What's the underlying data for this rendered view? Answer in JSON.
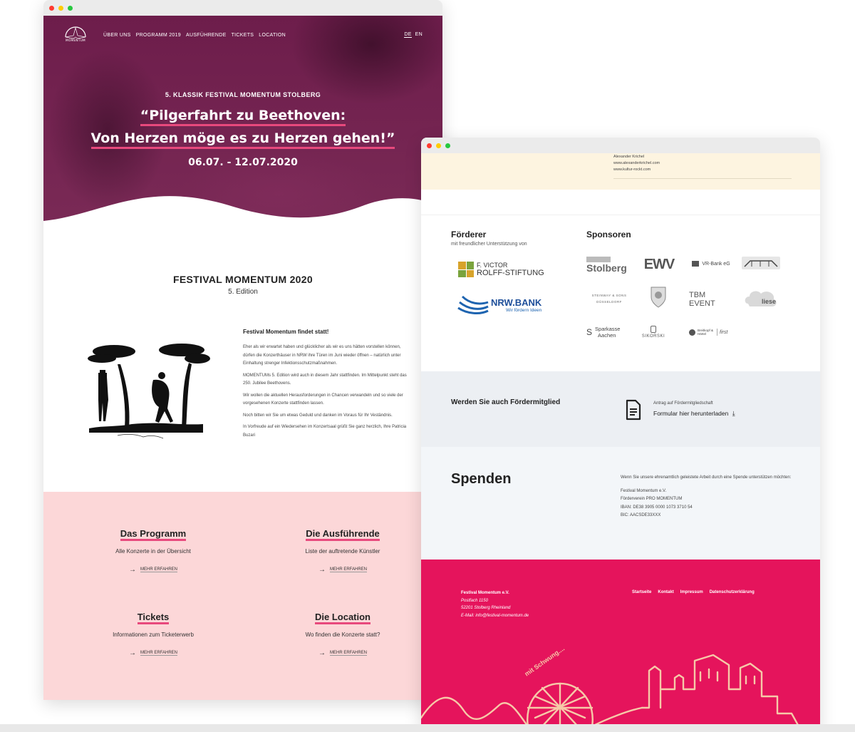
{
  "left_window": {
    "nav": {
      "logo_text": "MOMENTUM",
      "items": [
        "ÜBER UNS",
        "PROGRAMM 2019",
        "AUSFÜHRENDE",
        "TICKETS",
        "LOCATION"
      ],
      "lang_de": "DE",
      "lang_en": "EN"
    },
    "hero": {
      "kicker": "5. KLASSIK FESTIVAL MOMENTUM STOLBERG",
      "title_line1": "“Pilgerfahrt zu Beethoven:",
      "title_line2": "Von Herzen möge es zu Herzen gehen!”",
      "date": "06.07. - 12.07.2020"
    },
    "intro": {
      "title": "FESTIVAL MOMENTUM 2020",
      "subtitle": "5. Edition"
    },
    "news": {
      "heading": "Festival Momentum findet statt!",
      "paragraphs": [
        "Eher als wir erwartet haben und glücklicher als wir es uns hätten vorstellen können, dürfen die Konzerthäuser in NRW ihre Türen im Juni wieder öffnen – natürlich unter Einhaltung strenger Infektionsschutzmaßnahmen.",
        "MOMENTUMs 5. Edition wird auch in diesem Jahr stattfinden. Im Mittelpunkt steht das 250. Jubilee Beethovens.",
        "Wir wollen die aktuellen Herausforderungen in Chancen verwandeln und so viele der vorgesehenen Konzerte stattfinden lassen.",
        "Noch bitten wir Sie um etwas Geduld und danken im Voraus für Ihr Veständnis.",
        "In Vorfreude auf ein Wiedersehen im Konzertsaal grüßt Sie ganz herzlich, Ihre Patricia Buzari"
      ]
    },
    "cards": [
      {
        "title": "Das Programm",
        "text": "Alle Konzerte in der Übersicht",
        "link": "MEHR ERFAHREN"
      },
      {
        "title": "Die Ausführende",
        "text": "Liste der auftretende Künstler",
        "link": "MEHR ERFAHREN"
      },
      {
        "title": "Tickets",
        "text": "Informationen zum Ticketerwerb",
        "link": "MEHR ERFAHREN"
      },
      {
        "title": "Die Location",
        "text": "Wo finden die Konzerte statt?",
        "link": "MEHR ERFAHREN"
      }
    ]
  },
  "right_window": {
    "cream": {
      "line0": "Alexander Krichel",
      "line1": "www.alexanderkrichel.com",
      "line2": "www.kultur-rockt.com"
    },
    "foerderer": {
      "title": "Förderer",
      "subtitle": "mit freundlicher Unterstützung von",
      "rolff_line1": "F. VICTOR",
      "rolff_line2": "ROLFF-STIFTUNG",
      "nrw_name": "NRW.BANK",
      "nrw_tagline": "Wir fördern Ideen"
    },
    "sponsoren": {
      "title": "Sponsoren",
      "stolberg": "Stolberg",
      "ewv": "EWV",
      "vrbank": "VR-Bank eG",
      "steinway": "STEINWAY & SONS DÜSSELDORF",
      "tbm": "TBM EVENT",
      "liese": "liese",
      "sparkasse_1": "Sparkasse",
      "sparkasse_2": "Aachen",
      "sikorski": "SIKORSKI",
      "breitkopf": "Breitkopf & Härtel",
      "first": "first"
    },
    "member": {
      "title": "Werden Sie auch Fördermitglied",
      "caption": "Antrag auf Fördermitgliedschaft",
      "link": "Formular hier herunterladen"
    },
    "spenden": {
      "title": "Spenden",
      "intro": "Wenn Sie unsere ehrenamtlich geleistete Arbeit durch eine Spende unterstützen möchten:",
      "lines": [
        "Festival Momentum e.V.",
        "Förderverein PRO MOMENTUM",
        "IBAN: DE38 3905 0000 1073 3710 54",
        "BIC: AACSDE33XXX"
      ]
    },
    "footer": {
      "org": "Festival Momentum e.V.",
      "postfach": "Postfach 1150",
      "city": "52201 Stolberg Rheinland",
      "email": "E-Mail: info@festival-momentum.de",
      "links": [
        "Startseite",
        "Kontakt",
        "Impressum",
        "Datenschutzerklärung"
      ],
      "slogan": "mit Schwung...."
    }
  },
  "colors": {
    "accent": "#e8497d",
    "hero": "#6e1f4c",
    "pink_section": "#fcd7d8",
    "footer": "#e5145c",
    "cream": "#fdf4e0"
  }
}
